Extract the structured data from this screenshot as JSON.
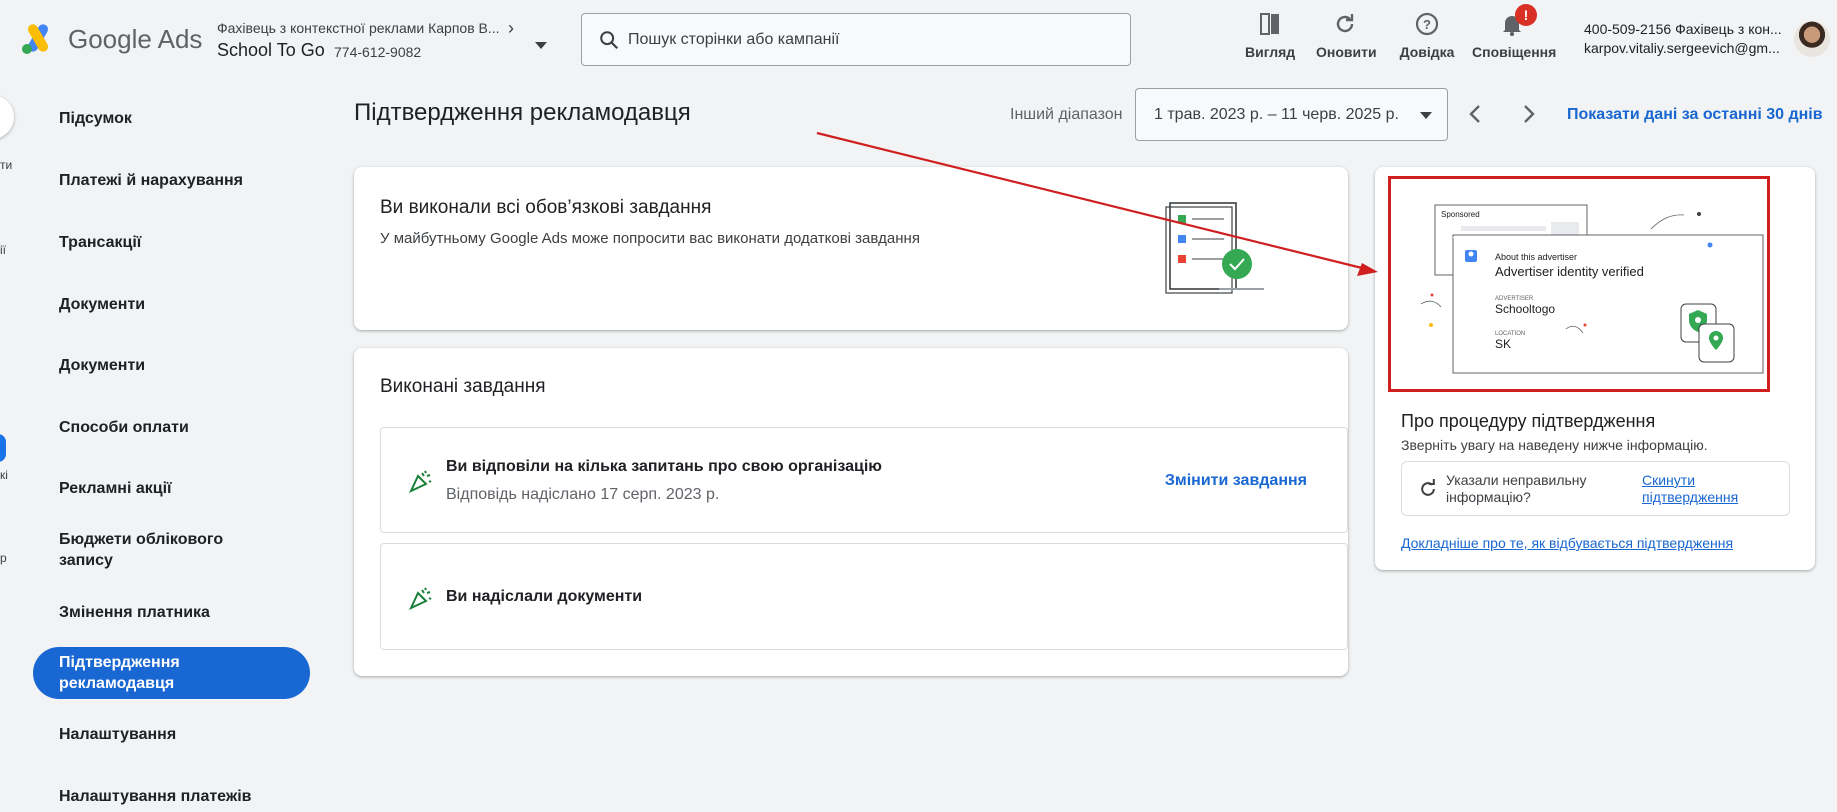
{
  "header": {
    "product_name": "Google Ads",
    "account_breadcrumb": "Фахівець з контекстної реклами Карпов В...",
    "account_name": "School To Go",
    "account_id": "774-612-9082",
    "search_placeholder": "Пошук сторінки або кампанії",
    "buttons": {
      "view": "Вигляд",
      "refresh": "Оновити",
      "help": "Довідка",
      "notifications": "Сповіщення"
    },
    "notification_badge": "!",
    "user_line1": "400-509-2156 Фахівець з кон...",
    "user_line2": "karpov.vitaliy.sergeevich@gm..."
  },
  "left_strip": {
    "text1": "ти",
    "text2": "ії",
    "text3": "кі",
    "text4": "р"
  },
  "sidebar": {
    "items": [
      {
        "label": "Підсумок"
      },
      {
        "label": "Платежі й нарахування"
      },
      {
        "label": "Трансакції"
      },
      {
        "label": "Документи"
      },
      {
        "label": "Документи"
      },
      {
        "label": "Способи оплати"
      },
      {
        "label": "Рекламні акції"
      },
      {
        "label": "Бюджети облікового запису"
      },
      {
        "label": "Змінення платника"
      },
      {
        "label": "Підтвердження рекламодавця"
      },
      {
        "label": "Налаштування"
      },
      {
        "label": "Налаштування платежів"
      }
    ]
  },
  "main": {
    "title": "Підтвердження рекламодавця",
    "range_label": "Інший діапазон",
    "date_range": "1 трав. 2023 р. – 11 черв. 2025 р.",
    "last_30_link": "Показати дані за останні 30 днів",
    "summary_card": {
      "title": "Ви виконали всі обов’язкові завдання",
      "subtitle": "У майбутньому Google Ads може попросити вас виконати додаткові завдання"
    },
    "completed_card": {
      "title": "Виконані завдання",
      "tasks": [
        {
          "title": "Ви відповіли на кілька запитань про свою організацію",
          "subtitle": "Відповідь надіслано 17 серп. 2023 р.",
          "action": "Змінити завдання"
        },
        {
          "title": "Ви надіслали документи"
        }
      ]
    }
  },
  "side_panel": {
    "illustration": {
      "sponsored": "Sponsored",
      "about": "About this advertiser",
      "verified": "Advertiser identity verified",
      "advertiser_label": "ADVERTISER",
      "advertiser_value": "Schooltogo",
      "location_label": "LOCATION",
      "location_value": "SK"
    },
    "heading": "Про процедуру підтвердження",
    "subheading": "Зверніть увагу на наведену нижче інформацію.",
    "wrong_info": "Указали неправильну інформацію?",
    "reset_link": "Скинути підтвердження",
    "more_link": "Докладніше про те, як відбувається підтвердження"
  },
  "colors": {
    "accent": "#1967d2",
    "annotation_red": "#d01f1f",
    "success_green": "#34a853"
  }
}
